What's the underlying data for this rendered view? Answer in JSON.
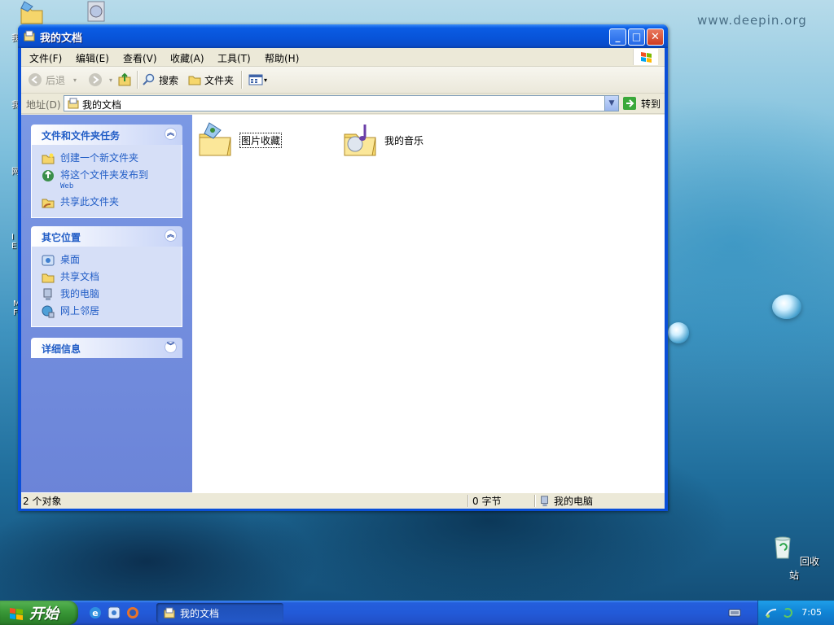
{
  "desktop": {
    "watermark": "www.deepin.org",
    "recycle_bin_label": "回收站"
  },
  "window": {
    "title": "我的文档",
    "buttons": {
      "minimize": "_",
      "maximize": "□",
      "close": "✕"
    }
  },
  "menu": {
    "items": [
      "文件(F)",
      "编辑(E)",
      "查看(V)",
      "收藏(A)",
      "工具(T)",
      "帮助(H)"
    ]
  },
  "toolbar": {
    "back": "后退",
    "search": "搜索",
    "folders": "文件夹"
  },
  "address": {
    "label": "地址(D)",
    "value": "我的文档",
    "go": "转到"
  },
  "taskpane": {
    "file_tasks": {
      "title": "文件和文件夹任务",
      "items": [
        {
          "label": "创建一个新文件夹",
          "sub": ""
        },
        {
          "label": "将这个文件夹发布到",
          "sub": "Web"
        },
        {
          "label": "共享此文件夹",
          "sub": ""
        }
      ]
    },
    "other_places": {
      "title": "其它位置",
      "items": [
        {
          "label": "桌面"
        },
        {
          "label": "共享文档"
        },
        {
          "label": "我的电脑"
        },
        {
          "label": "网上邻居"
        }
      ]
    },
    "details": {
      "title": "详细信息"
    }
  },
  "content": {
    "folders": [
      {
        "name": "图片收藏",
        "selected": true
      },
      {
        "name": "我的音乐",
        "selected": false
      }
    ]
  },
  "statusbar": {
    "objects": "2 个对象",
    "size": "0 字节",
    "location": "我的电脑"
  },
  "taskbar": {
    "start": "开始",
    "active_task": "我的文档",
    "clock": "7:05"
  },
  "colors": {
    "title_blue": "#0a5ce4",
    "link_blue": "#215dc6",
    "taskpane_blue": "#7b98e4",
    "start_green": "#3c9b3a"
  }
}
